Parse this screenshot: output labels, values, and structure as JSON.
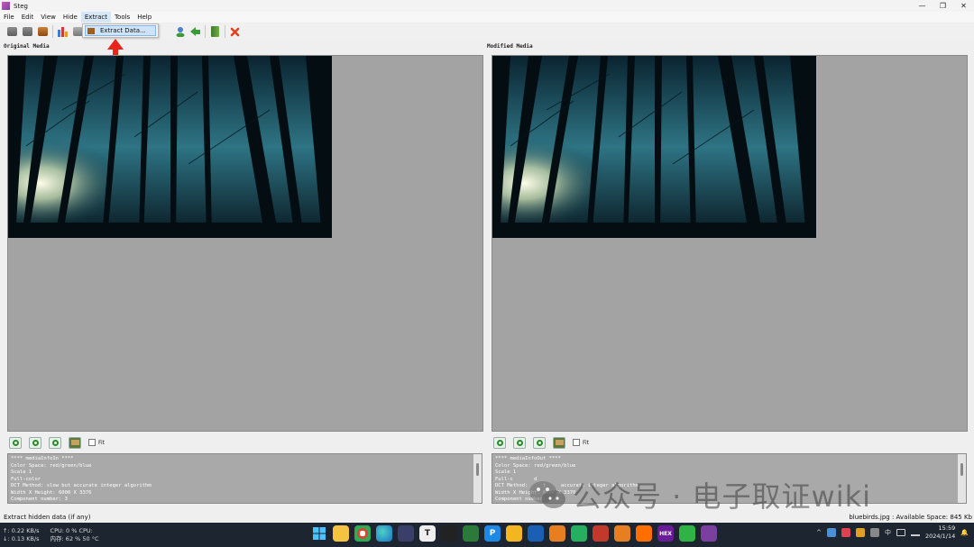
{
  "window": {
    "title": "Steg",
    "minimize": "—",
    "maximize": "❐",
    "close": "✕"
  },
  "menu": [
    {
      "label": "File"
    },
    {
      "label": "Edit"
    },
    {
      "label": "View"
    },
    {
      "label": "Hide"
    },
    {
      "label": "Extract"
    },
    {
      "label": "Tools"
    },
    {
      "label": "Help"
    }
  ],
  "extract_menu": {
    "item_label": "Extract Data..."
  },
  "annotation_color": "#e8261c",
  "panels": {
    "original": {
      "title": "Original Media",
      "info_text": "**** mediaInfoIn ****\nColor Space: red/green/blue\nScale 1\nFull-color\nDCT Method: slow but accurate integer algorithm\nWidth X Height: 6000 X 3376\nComponent number: 3"
    },
    "modified": {
      "title": "Modified Media",
      "info_text": "**** mediaInfoOut ****\nColor Space: red/green/blue\nScale 1\nFull-c       d\nDCT Method:     t     accurate integer algorithm\nWidth X Height: 6000 X 3376\nComponent number: 3"
    }
  },
  "zoom": {
    "fit_label": "Fit"
  },
  "status": {
    "left": "Extract hidden data (if any)",
    "right": "bluebirds.jpg : Available Space: 845 Kb"
  },
  "taskbar": {
    "net_up": "↑: 0.22 KB/s",
    "net_down": "↓: 0.13 KB/s",
    "cpu": "CPU: 0 %   CPU:",
    "mem": "内存: 62 %  50 °C",
    "time": "15:59",
    "date": "2024/1/14",
    "ime": "中",
    "tray_chevron": "^"
  },
  "watermark": {
    "text": "公众号 · 电子取证wiki"
  },
  "colors": {
    "view_bg": "#a3a3a3",
    "taskbar_bg": "#1c2530",
    "menu_highlight": "#cfe3f8"
  }
}
